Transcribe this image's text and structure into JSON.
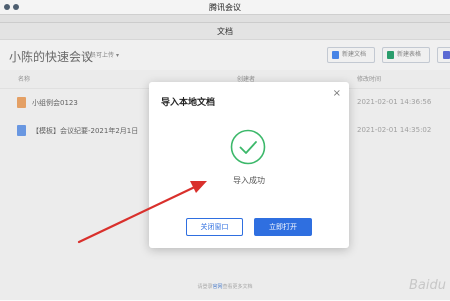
{
  "app": {
    "title": "腾讯会议"
  },
  "doc_window": {
    "title": "文档"
  },
  "header": {
    "meeting_title": "小陈的快速会议",
    "filter_label": "全员可上传",
    "new_doc_label": "新建文档",
    "new_sheet_label": "新建表格"
  },
  "columns": {
    "name": "名称",
    "creator": "创建者",
    "modified": "修改时间"
  },
  "files": [
    {
      "name": "小组例会0123",
      "modified": "2021-02-01 14:36:56"
    },
    {
      "name": "【模板】会议纪要-2021年2月1日",
      "modified": "2021-02-01 14:35:02"
    }
  ],
  "footer": {
    "note_prefix": "请登录",
    "note_link": "官网",
    "note_suffix": "查看更多文档"
  },
  "modal": {
    "title": "导入本地文档",
    "message": "导入成功",
    "close_window_label": "关闭窗口",
    "open_now_label": "立即打开",
    "close_glyph": "×"
  },
  "watermark": "Baidu",
  "colors": {
    "primary": "#2f6fe0",
    "success": "#3cb86a",
    "annotation": "#d9302c"
  }
}
